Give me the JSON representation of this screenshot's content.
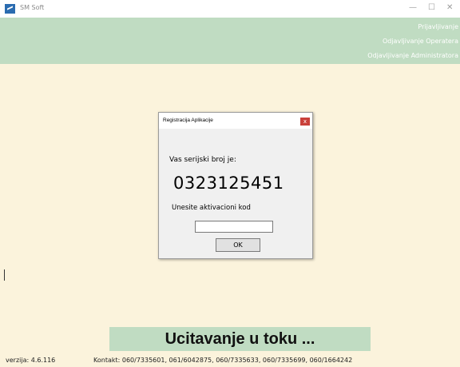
{
  "window": {
    "title": "SM Soft",
    "minimize_glyph": "—",
    "maximize_glyph": "☐",
    "close_glyph": "✕"
  },
  "menu": {
    "items": [
      "Prijavljivanje",
      "Odjavljivanje Operatera",
      "Odjavljivanje Administratora"
    ]
  },
  "dialog": {
    "title": "Registracija Aplikacije",
    "close_glyph": "x",
    "serial_label": "Vas serijski broj je:",
    "serial_number": "0323125451",
    "activation_label": "Unesite aktivacioni kod",
    "activation_value": "",
    "ok_label": "OK"
  },
  "status": {
    "loading_text": "Ucitavanje u toku ..."
  },
  "footer": {
    "version": "verzija: 4.6.116",
    "contact": "Kontakt: 060/7335601, 061/6042875, 060/7335633, 060/7335699, 060/1664242"
  },
  "colors": {
    "background": "#fbf3dc",
    "accent_green": "#c0dcc2",
    "dialog_close": "#c9403a"
  }
}
